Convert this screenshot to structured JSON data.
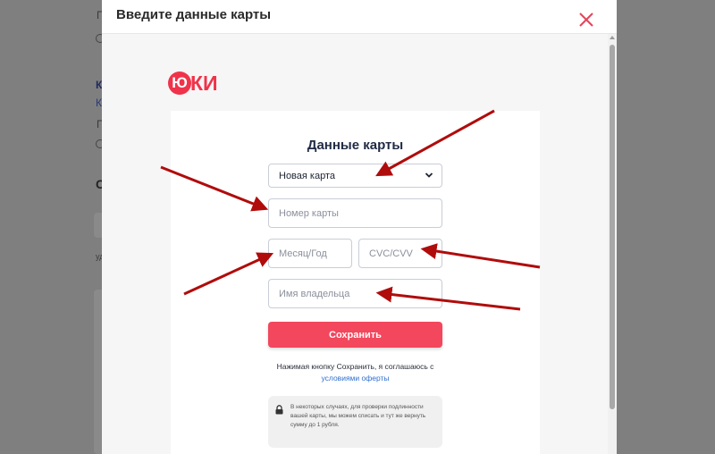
{
  "background": {
    "frag_p1": "П",
    "frag_k1": "К",
    "frag_k2": "К",
    "frag_p2": "П",
    "frag_c": "С",
    "frag_u": "уд"
  },
  "modal": {
    "title": "Введите данные карты",
    "close_icon": "close-icon"
  },
  "logo": {
    "ball_letter": "Ю",
    "text": "КИ",
    "color": "#f0334a"
  },
  "form": {
    "title": "Данные карты",
    "card_select": {
      "selected": "Новая карта"
    },
    "card_number": {
      "placeholder": "Номер карты"
    },
    "expiry": {
      "placeholder": "Месяц/Год"
    },
    "cvc": {
      "placeholder": "CVC/CVV"
    },
    "holder": {
      "placeholder": "Имя владельца"
    },
    "save_label": "Сохранить",
    "agree_text": "Нажимая кнопку Сохранить, я соглашаюсь с",
    "agree_link": "условиями оферты",
    "note": "В некоторых случаях, для проверки подлинности вашей карты, мы можем списать и тут же вернуть сумму до 1 рубля."
  },
  "colors": {
    "accent": "#f2475d",
    "link": "#2f6fcf",
    "arrow": "#b00c0c"
  }
}
